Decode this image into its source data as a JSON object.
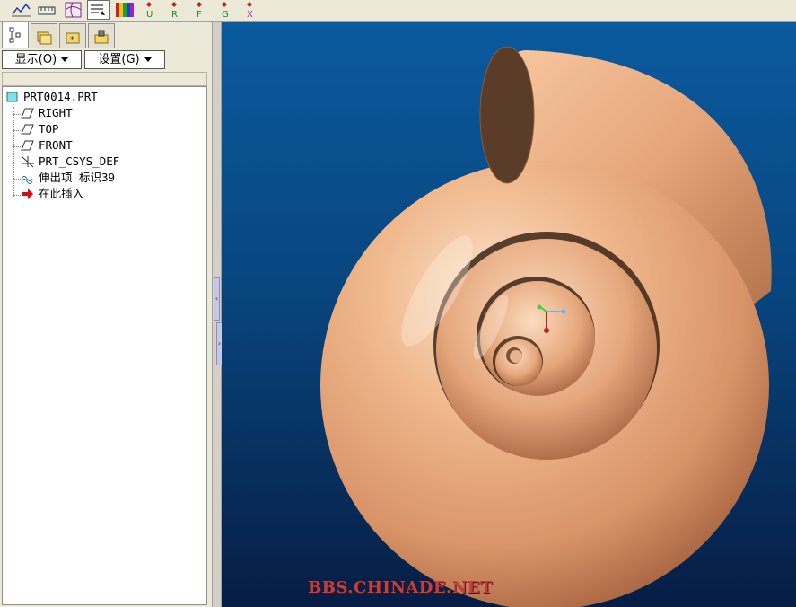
{
  "toolbar": {
    "buttons": [
      {
        "name": "datum-display-icon"
      },
      {
        "name": "measure-icon"
      },
      {
        "name": "mesh-icon"
      },
      {
        "name": "regenerate-icon"
      },
      {
        "name": "color-bars-icon"
      },
      {
        "name": "datum-u-icon",
        "label": "U",
        "color": "#1f8a1f"
      },
      {
        "name": "datum-r-icon",
        "label": "R",
        "color": "#1f8a1f"
      },
      {
        "name": "datum-f-icon",
        "label": "F",
        "color": "#1f8a1f"
      },
      {
        "name": "datum-g-icon",
        "label": "G",
        "color": "#1f8a1f"
      },
      {
        "name": "datum-x-icon",
        "label": "X",
        "color": "#a020c0"
      }
    ]
  },
  "panel": {
    "display_menu": "显示(O)",
    "settings_menu": "设置(G)"
  },
  "tree": {
    "root": "PRT0014.PRT",
    "items": [
      {
        "label": "RIGHT",
        "icon": "datum-plane-icon"
      },
      {
        "label": "TOP",
        "icon": "datum-plane-icon"
      },
      {
        "label": "FRONT",
        "icon": "datum-plane-icon"
      },
      {
        "label": "PRT_CSYS_DEF",
        "icon": "coordinate-system-icon"
      },
      {
        "label": "伸出项 标识39",
        "icon": "protrusion-icon"
      },
      {
        "label": "在此插入",
        "icon": "insert-here-arrow-icon"
      }
    ]
  },
  "viewport": {
    "watermark": "BBS.CHINADE.NET",
    "model_color": "#e3a67a"
  }
}
